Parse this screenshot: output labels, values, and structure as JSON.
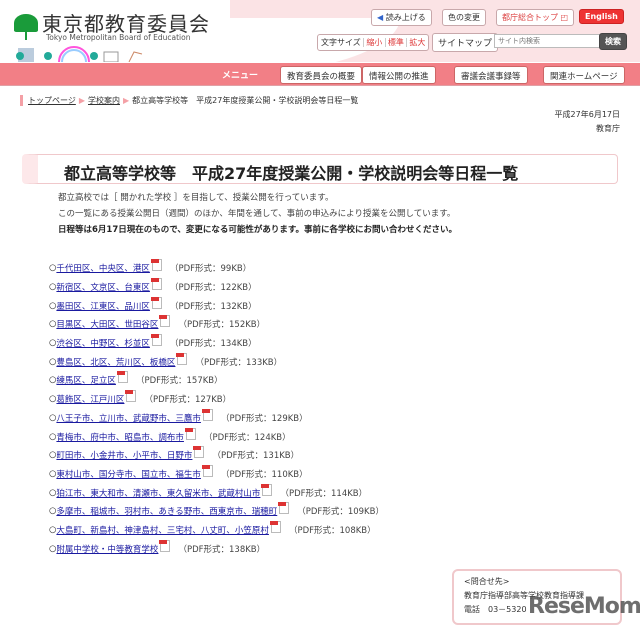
{
  "header": {
    "logo_jp": "東京都教育委員会",
    "logo_en": "Tokyo Metropolitan Board of Education",
    "read_aloud": "読み上げる",
    "color_change": "色の変更",
    "metro_top": "都庁総合トップ",
    "english": "English",
    "font_size_label": "文字サイズ",
    "font_small": "縮小",
    "font_standard": "標準",
    "font_large": "拡大",
    "sitemap": "サイトマップ",
    "search_placeholder": "サイト内検索",
    "search_button": "検索"
  },
  "menu": {
    "label": "メニュー",
    "items": [
      "教育委員会の概要",
      "情報公開の推進",
      "審議会議事録等",
      "関連ホームページ"
    ]
  },
  "breadcrumb": [
    "トップページ",
    "学校案内",
    "都立高等学校等　平成27年度授業公開・学校説明会等日程一覧"
  ],
  "date": "平成27年6月17日",
  "department": "教育庁",
  "title": "都立高等学校等　平成27年度授業公開・学校説明会等日程一覧",
  "paragraphs": [
    "都立高校では［ 開かれた学校 ］を目指して、授業公開を行っています。",
    "この一覧にある授業公開日（週間）のほか、年間を通して、事前の申込みにより授業を公開しています。",
    "日程等は6月17日現在のもので、変更になる可能性があります。事前に各学校にお問い合わせください。"
  ],
  "bullet": "○",
  "items": [
    {
      "label": "千代田区、中央区、港区",
      "size": "（PDF形式：99KB）"
    },
    {
      "label": "新宿区、文京区、台東区",
      "size": "（PDF形式：122KB）"
    },
    {
      "label": "墨田区、江東区、品川区",
      "size": "（PDF形式：132KB）"
    },
    {
      "label": "目黒区、大田区、世田谷区",
      "size": "（PDF形式：152KB）"
    },
    {
      "label": "渋谷区、中野区、杉並区",
      "size": "（PDF形式：134KB）"
    },
    {
      "label": "豊島区、北区、荒川区、板橋区",
      "size": "（PDF形式：133KB）"
    },
    {
      "label": "練馬区、足立区",
      "size": "（PDF形式：157KB）"
    },
    {
      "label": "葛飾区、江戸川区",
      "size": "（PDF形式：127KB）"
    },
    {
      "label": "八王子市、立川市、武蔵野市、三鷹市",
      "size": "（PDF形式：129KB）"
    },
    {
      "label": "青梅市、府中市、昭島市、調布市",
      "size": "（PDF形式：124KB）"
    },
    {
      "label": "町田市、小金井市、小平市、日野市",
      "size": "（PDF形式：131KB）"
    },
    {
      "label": "東村山市、国分寺市、国立市、福生市",
      "size": "（PDF形式：110KB）"
    },
    {
      "label": "狛江市、東大和市、清瀬市、東久留米市、武蔵村山市",
      "size": "（PDF形式：114KB）"
    },
    {
      "label": "多摩市、稲城市、羽村市、あきる野市、西東京市、瑞穂町",
      "size": "（PDF形式：109KB）"
    },
    {
      "label": "大島町、新島村、神津島村、三宅村、八丈町、小笠原村",
      "size": "（PDF形式：108KB）"
    },
    {
      "label": "附属中学校・中等教育学校",
      "size": "（PDF形式：138KB）"
    }
  ],
  "contact": {
    "heading": "<問合せ先>",
    "dept": "教育庁指導部高等学校教育指導課",
    "phone": "電話　03－5320"
  },
  "watermark": "ReseMom"
}
